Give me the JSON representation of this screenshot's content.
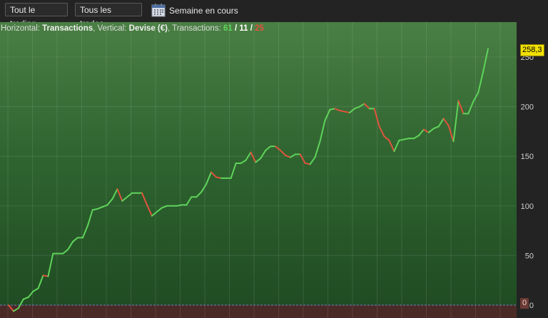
{
  "toolbar": {
    "scope_label": "Tout le trading",
    "trades_label": "Tous les trades",
    "period_label": "Semaine en cours",
    "calendar_icon": "calendar-icon"
  },
  "info": {
    "horizontal_label": "Horizontal:",
    "horizontal_value": "Transactions",
    "vertical_label": ", Vertical:",
    "vertical_value": "Devise (€)",
    "transactions_label": ", Transactions:",
    "count_total": "61",
    "sep1": " / ",
    "count_mid": "11",
    "sep2": " / ",
    "count_loss": "25"
  },
  "colors": {
    "up": "#5fd35a",
    "down": "#e2533c",
    "badge": "#f2e000"
  },
  "chart_data": {
    "type": "line",
    "current_value_label": "258,3",
    "zero_label": "0",
    "y_ticks": [
      0,
      50,
      100,
      150,
      200,
      250
    ],
    "y_tick_labels": [
      "0",
      "50",
      "100",
      "150",
      "200",
      "250"
    ],
    "ylim": [
      -12,
      280
    ],
    "grid": true,
    "x_gridline_count": 21,
    "series": [
      {
        "values": [
          0,
          -6,
          -3,
          6,
          8,
          14,
          17,
          30,
          29,
          52,
          52,
          52,
          56,
          64,
          68,
          68,
          80,
          96,
          97,
          99,
          101,
          107,
          117,
          105,
          109,
          113,
          113,
          113,
          101,
          90,
          94,
          98,
          100,
          100,
          100,
          101,
          101,
          109,
          109,
          114,
          122,
          134,
          129,
          128,
          128,
          128,
          143,
          143,
          146,
          154,
          144,
          148,
          156,
          160,
          160,
          156,
          151,
          149,
          152,
          152,
          143,
          142,
          149,
          165,
          186,
          197,
          198,
          196,
          195,
          194,
          198,
          200,
          203,
          198,
          198,
          180,
          170,
          166,
          155,
          166,
          167,
          168,
          168,
          171,
          177,
          174,
          178,
          180,
          188,
          181,
          165,
          206,
          193,
          193,
          205,
          214,
          235,
          258.3
        ]
      }
    ]
  }
}
